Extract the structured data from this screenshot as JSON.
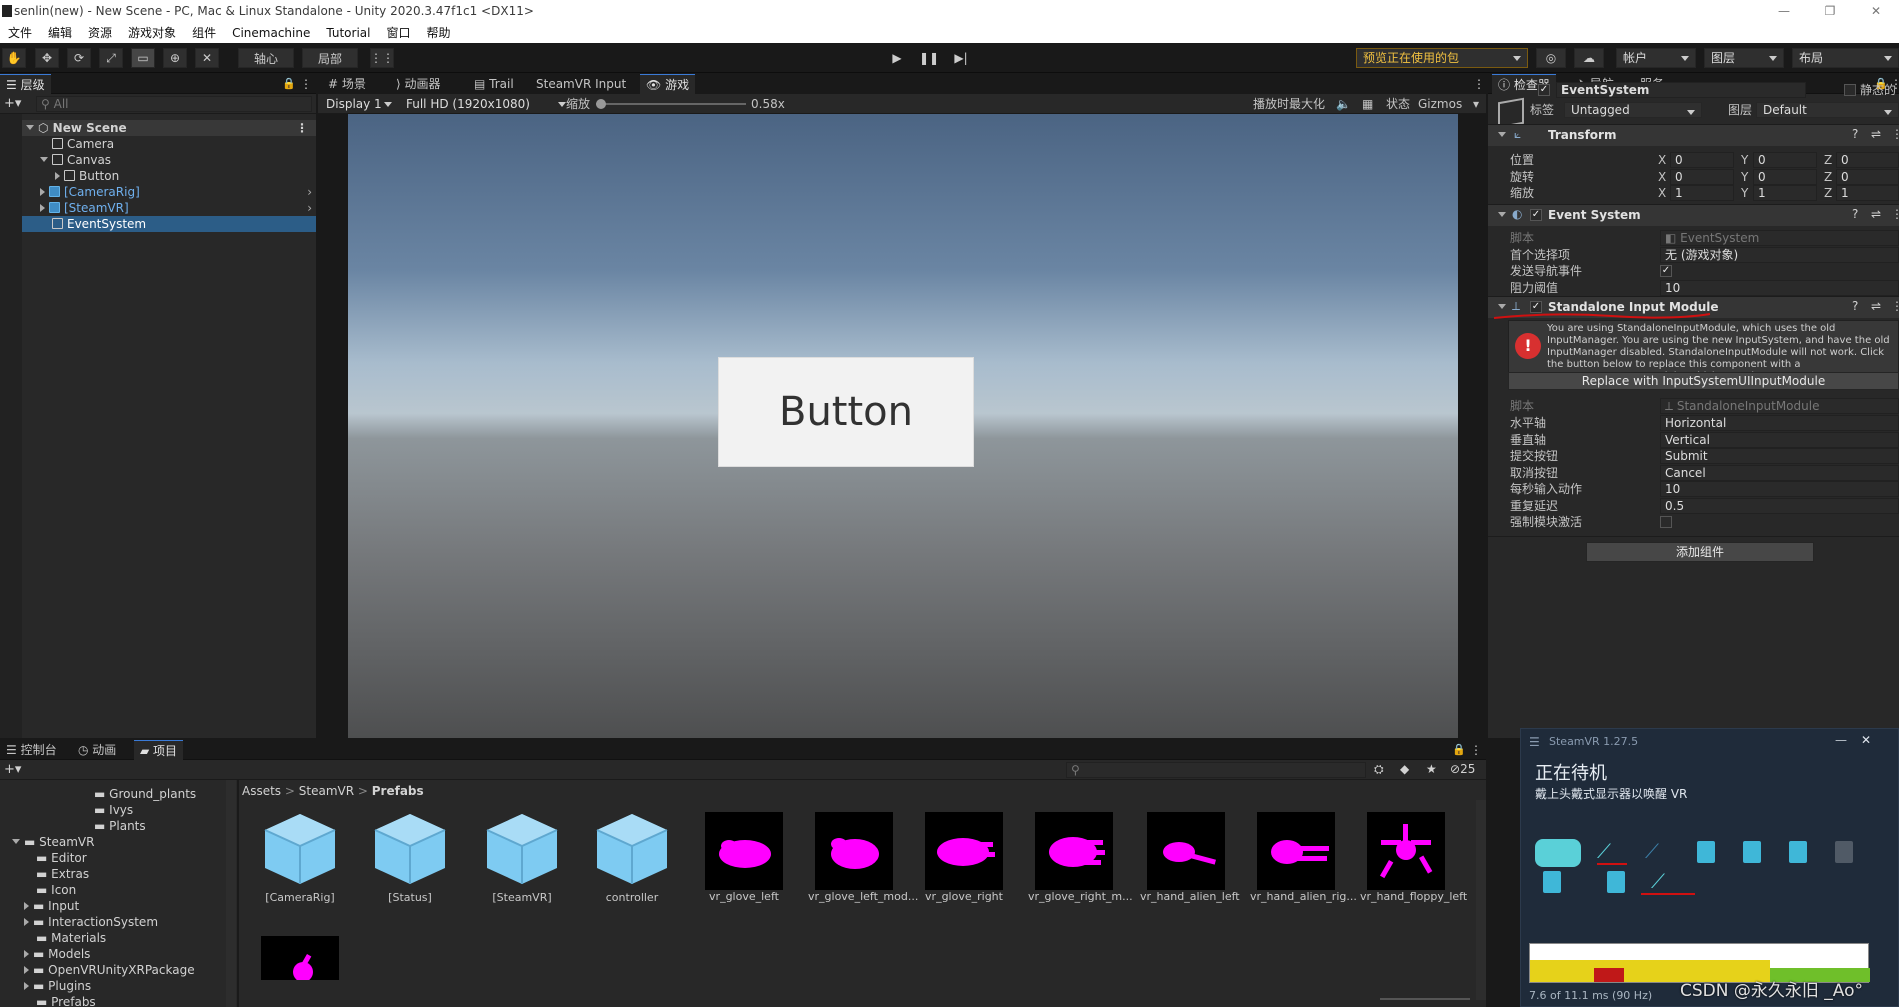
{
  "window": {
    "title": "senlin(new) - New Scene - PC, Mac & Linux Standalone - Unity 2020.3.47f1c1 <DX11>",
    "controls": [
      "—",
      "❐",
      "✕"
    ]
  },
  "menu": [
    "文件",
    "编辑",
    "资源",
    "游戏对象",
    "组件",
    "Cinemachine",
    "Tutorial",
    "窗口",
    "帮助"
  ],
  "toolbar": {
    "pivot": "轴心",
    "local": "局部",
    "package_preview": "预览正在使用的包",
    "account": "帐户",
    "layers": "图层",
    "layout": "布局"
  },
  "hierarchy": {
    "tab": "层级",
    "search_placeholder": "All",
    "scene": "New Scene",
    "items": [
      "Camera",
      "Canvas",
      "Button",
      "[CameraRig]",
      "[SteamVR]",
      "EventSystem"
    ]
  },
  "game_view": {
    "tabs": [
      "场景",
      "动画器",
      "Trail",
      "SteamVR Input",
      "游戏"
    ],
    "display": "Display 1",
    "resolution": "Full HD (1920x1080)",
    "scale_label": "缩放",
    "scale_value": "0.58x",
    "maximize_on_play": "播放时最大化",
    "stats": "状态",
    "gizmos": "Gizmos",
    "button_text": "Button"
  },
  "inspector": {
    "tabs": [
      "检查器",
      "导航",
      "服务"
    ],
    "object_name": "EventSystem",
    "static": "静态的",
    "tag_label": "标签",
    "tag_value": "Untagged",
    "layer_label": "图层",
    "layer_value": "Default",
    "transform": {
      "title": "Transform",
      "position_label": "位置",
      "rotation_label": "旋转",
      "scale_label": "缩放",
      "position": [
        "0",
        "0",
        "0"
      ],
      "rotation": [
        "0",
        "0",
        "0"
      ],
      "scale": [
        "1",
        "1",
        "1"
      ]
    },
    "event_system": {
      "title": "Event System",
      "script_label": "脚本",
      "script_value": "EventSystem",
      "first_selected_label": "首个选择项",
      "first_selected_value": "无 (游戏对象)",
      "send_nav_label": "发送导航事件",
      "drag_threshold_label": "阻力阈值",
      "drag_threshold_value": "10"
    },
    "input_module": {
      "title": "Standalone Input Module",
      "warning": "You are using StandaloneInputModule, which uses the old InputManager. You are using the new InputSystem, and have the old InputManager disabled. StandaloneInputModule will not work. Click the button below to replace this component with a InputSystemUIInputModule, which uses the new InputSystem.",
      "replace_button": "Replace with InputSystemUIInputModule",
      "script_label": "脚本",
      "script_value": "StandaloneInputModule",
      "fields": [
        {
          "label": "水平轴",
          "value": "Horizontal"
        },
        {
          "label": "垂直轴",
          "value": "Vertical"
        },
        {
          "label": "提交按钮",
          "value": "Submit"
        },
        {
          "label": "取消按钮",
          "value": "Cancel"
        },
        {
          "label": "每秒输入动作",
          "value": "10"
        },
        {
          "label": "重复延迟",
          "value": "0.5"
        }
      ],
      "force_module_label": "强制模块激活"
    },
    "add_component": "添加组件"
  },
  "bottom": {
    "tabs": [
      "控制台",
      "动画",
      "项目"
    ],
    "hidden_count": "25",
    "breadcrumb": [
      "Assets",
      "SteamVR",
      "Prefabs"
    ],
    "tree": [
      "Ground_plants",
      "Ivys",
      "Plants",
      "SteamVR",
      "Editor",
      "Extras",
      "Icon",
      "Input",
      "InteractionSystem",
      "Materials",
      "Models",
      "OpenVRUnityXRPackage",
      "Plugins",
      "Prefabs"
    ],
    "assets": [
      "[CameraRig]",
      "[Status]",
      "[SteamVR]",
      "controller",
      "vr_glove_left",
      "vr_glove_left_mod...",
      "vr_glove_right",
      "vr_glove_right_m...",
      "vr_hand_alien_left",
      "vr_hand_alien_rig...",
      "vr_hand_floppy_left"
    ]
  },
  "steamvr": {
    "title": "SteamVR 1.27.5",
    "status": "正在待机",
    "hint": "戴上头戴式显示器以唤醒 VR",
    "frame_time": "7.6 of 11.1 ms (90 Hz)"
  },
  "watermark": "CSDN @永久永旧 _Ao°",
  "colors": {
    "accent": "#2c5d87",
    "magenta": "#ff00ff",
    "cube": "#7ecbf2",
    "annotation": "#d01010"
  }
}
